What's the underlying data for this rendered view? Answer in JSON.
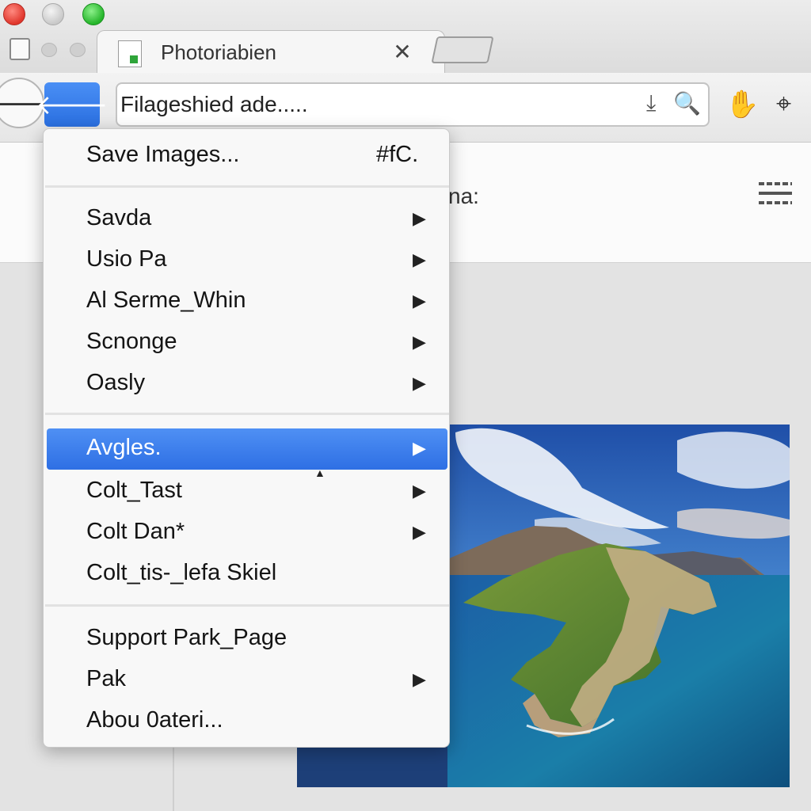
{
  "tab": {
    "title": "Photoriabien",
    "close_glyph": "✕",
    "favicon": "page-icon"
  },
  "toolbar": {
    "back_glyph": "🡐",
    "back_blue_glyph": "🡐",
    "address_value": "Filageshied ade.....",
    "download_glyph": "⤓",
    "search_glyph": "🔍",
    "hand_glyph": "✋",
    "crosshair_glyph": "⌖"
  },
  "page": {
    "partial_label": "na:"
  },
  "menu": {
    "items": [
      {
        "label": "Save Images...",
        "shortcut": "#fC.",
        "submenu": false
      },
      {
        "label": "Savda",
        "submenu": true
      },
      {
        "label": "Usio Pa",
        "submenu": true
      },
      {
        "label": "Al Serme_Whin",
        "submenu": true
      },
      {
        "label": "Scnonge",
        "submenu": true
      },
      {
        "label": "Oasly",
        "submenu": true
      },
      {
        "label": "Avgles.",
        "submenu": true,
        "selected": true
      },
      {
        "label": "Colt_Tast",
        "submenu": true
      },
      {
        "label": "Colt Dan*",
        "submenu": true
      },
      {
        "label": "Colt_tis-_lefa Skiel",
        "submenu": false
      },
      {
        "label": "Support Park_Page",
        "submenu": false
      },
      {
        "label": "Pak",
        "submenu": true
      },
      {
        "label": "Abou 0ateri...",
        "submenu": false
      }
    ],
    "arrow_glyph": "▶"
  },
  "colors": {
    "accent": "#2e6fe4",
    "close": "#e0362c",
    "maximize": "#25b52a"
  }
}
